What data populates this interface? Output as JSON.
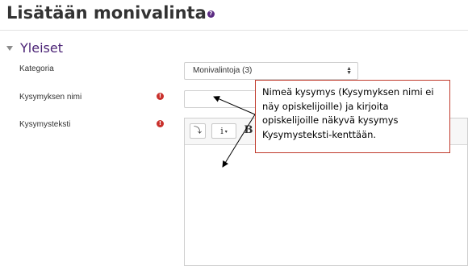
{
  "header": {
    "title": "Lisätään monivalinta",
    "help_icon": "question-circle-icon"
  },
  "section": {
    "title": "Yleiset",
    "collapse_icon": "caret-down-icon"
  },
  "fields": {
    "category": {
      "label": "Kategoria",
      "value": "Monivalintoja (3)"
    },
    "question_name": {
      "label": "Kysymyksen nimi",
      "value": "",
      "required_icon": "exclamation-circle-icon"
    },
    "question_text": {
      "label": "Kysymysteksti",
      "required_icon": "exclamation-circle-icon"
    }
  },
  "editor": {
    "toolbar": {
      "toggle_icon": "toolbar-toggle-icon",
      "toggle_glyph": "⤵",
      "info_label": "i",
      "info_dropdown": "▾",
      "bold_label": "B"
    }
  },
  "callout": {
    "text": "Nimeä kysymys (Kysymyksen nimi ei näy opiskelijoille) ja kirjoita opiskelijoille näkyvä kysymys Kysymysteksti-kenttään."
  },
  "colors": {
    "brand_purple": "#4a2275",
    "required_red": "#c9302c",
    "callout_border": "#c0392b"
  }
}
